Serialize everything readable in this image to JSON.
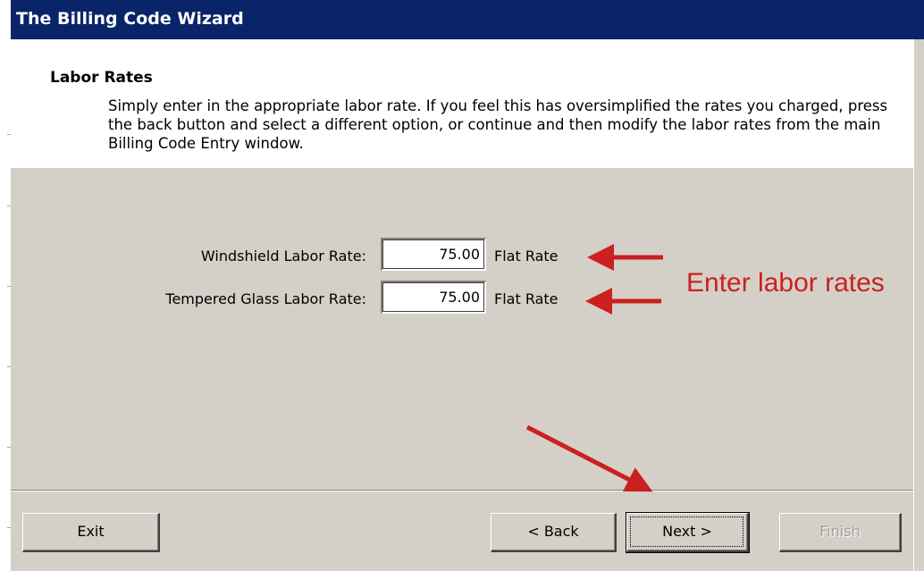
{
  "window": {
    "title": "The Billing Code Wizard"
  },
  "header": {
    "title": "Labor Rates",
    "description": "Simply enter in the appropriate labor rate.  If you feel this has oversimplified the rates you charged, press the back button and select a different option, or continue and then modify the labor rates from the main Billing Code Entry window."
  },
  "form": {
    "windshield": {
      "label": "Windshield Labor Rate:",
      "value": "75.00",
      "suffix": "Flat Rate"
    },
    "tempered": {
      "label": "Tempered Glass Labor Rate:",
      "value": "75.00",
      "suffix": "Flat Rate"
    }
  },
  "annotation": {
    "text": "Enter labor rates",
    "color": "#cc1f1f"
  },
  "buttons": {
    "exit": "Exit",
    "back": "< Back",
    "next": "Next >",
    "finish": "Finish"
  },
  "colors": {
    "titlebar": "#0a246a",
    "panel": "#d4d0c8",
    "arrow": "#cc1f1f"
  }
}
